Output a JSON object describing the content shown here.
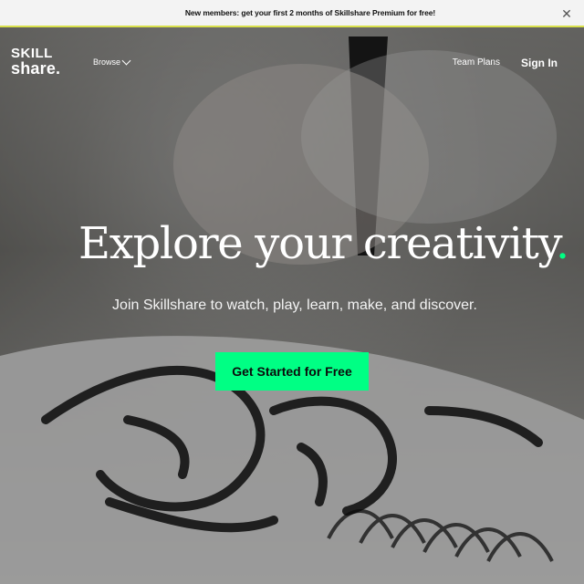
{
  "announcement": {
    "text": "New members: get your first 2 months of Skillshare Premium for free!",
    "close_icon": "close-icon"
  },
  "header": {
    "logo": {
      "line1": "SKILL",
      "line2": "share."
    },
    "browse_label": "Browse",
    "team_plans_label": "Team Plans",
    "sign_in_label": "Sign In"
  },
  "hero": {
    "title": "Explore your creativity",
    "title_dot": ".",
    "subtitle": "Join Skillshare to watch, play, learn, make, and discover.",
    "cta_label": "Get Started for Free",
    "accent_color": "#00ff84"
  }
}
